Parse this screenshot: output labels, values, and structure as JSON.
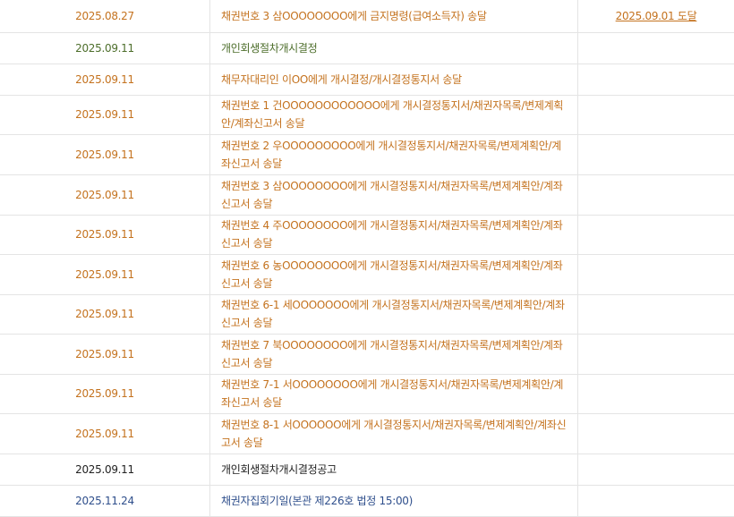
{
  "columns": [
    "date",
    "content",
    "result"
  ],
  "colors": {
    "orange": "#c4721e",
    "green": "#4d6e2b",
    "dark": "#222222",
    "blue": "#2f4f8c",
    "border": "#e4e4e4"
  },
  "rows": [
    {
      "date": "2025.08.27",
      "content": "채권번호 3 삼OOOOOOOO에게 금지명령(급여소득자) 송달",
      "result": "2025.09.01 도달"
    },
    {
      "date": "2025.09.11",
      "content": "개인회생절차개시결정",
      "result": ""
    },
    {
      "date": "2025.09.11",
      "content": "채무자대리인 이OO에게 개시결정/개시결정통지서 송달",
      "result": ""
    },
    {
      "date": "2025.09.11",
      "content": "채권번호 1 건OOOOOOOOOOOO에게 개시결정통지서/채권자목록/변제계획안/계좌신고서 송달",
      "result": ""
    },
    {
      "date": "2025.09.11",
      "content": "채권번호 2 우OOOOOOOOO에게 개시결정통지서/채권자목록/변제계획안/계좌신고서 송달",
      "result": ""
    },
    {
      "date": "2025.09.11",
      "content": "채권번호 3 삼OOOOOOOO에게 개시결정통지서/채권자목록/변제계획안/계좌신고서 송달",
      "result": ""
    },
    {
      "date": "2025.09.11",
      "content": "채권번호 4 주OOOOOOOO에게 개시결정통지서/채권자목록/변제계획안/계좌신고서 송달",
      "result": ""
    },
    {
      "date": "2025.09.11",
      "content": "채권번호 6 농OOOOOOOO에게 개시결정통지서/채권자목록/변제계획안/계좌신고서 송달",
      "result": ""
    },
    {
      "date": "2025.09.11",
      "content": "채권번호 6-1 세OOOOOOO에게 개시결정통지서/채권자목록/변제계획안/계좌신고서 송달",
      "result": ""
    },
    {
      "date": "2025.09.11",
      "content": "채권번호 7 북OOOOOOOO에게 개시결정통지서/채권자목록/변제계획안/계좌신고서 송달",
      "result": ""
    },
    {
      "date": "2025.09.11",
      "content": "채권번호 7-1 서OOOOOOOO에게 개시결정통지서/채권자목록/변제계획안/계좌신고서 송달",
      "result": ""
    },
    {
      "date": "2025.09.11",
      "content": "채권번호 8-1 서OOOOOO에게 개시결정통지서/채권자목록/변제계획안/계좌신고서 송달",
      "result": ""
    },
    {
      "date": "2025.09.11",
      "content": "개인회생절차개시결정공고",
      "result": ""
    },
    {
      "date": "2025.11.24",
      "content": "채권자집회기일(본관 제226호 법정 15:00)",
      "result": ""
    }
  ]
}
